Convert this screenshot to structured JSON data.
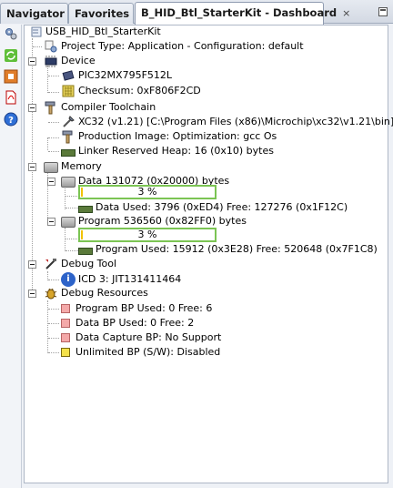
{
  "tabs": {
    "navigator": "Navigator",
    "favorites": "Favorites",
    "dashboard": "B_HID_Btl_StarterKit - Dashboard",
    "close_glyph": "×"
  },
  "toolbar": {
    "icons": [
      "settings-icon",
      "refresh-icon",
      "stop-icon",
      "pdf-icon",
      "help-icon"
    ]
  },
  "tree": {
    "root": "USB_HID_Btl_StarterKit",
    "project_type": "Project Type: Application - Configuration: default",
    "device": "Device",
    "device_name": "PIC32MX795F512L",
    "checksum": "Checksum: 0xF806F2CD",
    "compiler": "Compiler Toolchain",
    "xc32": "XC32 (v1.21) [C:\\Program Files (x86)\\Microchip\\xc32\\v1.21\\bin]",
    "production_image": "Production Image: Optimization: gcc Os",
    "linker_heap": "Linker Reserved Heap:  16 (0x10) bytes",
    "memory": "Memory",
    "data_mem": "Data 131072 (0x20000) bytes",
    "data_percent": "3 %",
    "data_percent_value": 3,
    "data_used": "Data Used: 3796 (0xED4) Free: 127276 (0x1F12C)",
    "program_mem": "Program 536560 (0x82FF0) bytes",
    "program_percent": "3 %",
    "program_percent_value": 3,
    "program_used": "Program Used: 15912 (0x3E28) Free: 520648 (0x7F1C8)",
    "debug_tool": "Debug Tool",
    "icd": "ICD 3: JIT131411464",
    "debug_resources": "Debug Resources",
    "program_bp": "Program BP Used: 0  Free: 6",
    "data_bp": "Data BP Used: 0  Free: 2",
    "data_capture_bp": "Data Capture BP: No Support",
    "unlimited_bp": "Unlimited BP (S/W): Disabled"
  },
  "colors": {
    "bar_border": "#7bc453",
    "bar_fill": "#f2c200"
  }
}
